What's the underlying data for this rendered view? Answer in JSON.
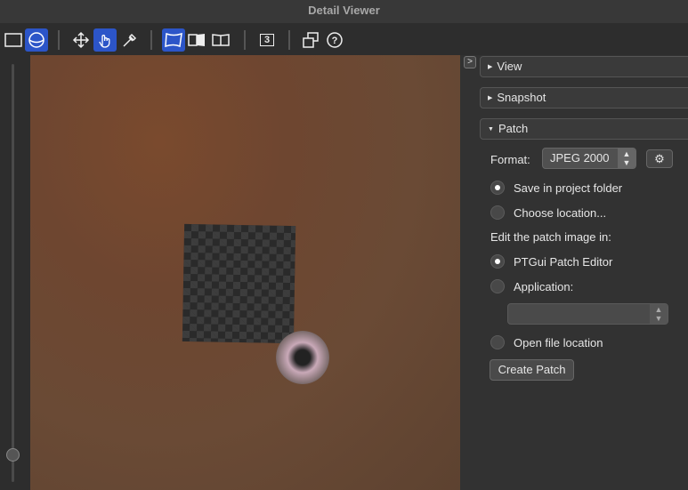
{
  "window": {
    "title": "Detail Viewer"
  },
  "toolbar": {
    "icons": [
      "rectangle-view-icon",
      "sphere-view-icon",
      "move-icon",
      "hand-icon",
      "eyedropper-icon",
      "flat-projection-icon",
      "half-projection-icon",
      "book-projection-icon",
      "three-badge-icon",
      "windows-icon",
      "help-icon"
    ],
    "badge": "3",
    "accent": "#2c55c8"
  },
  "panel": {
    "collapse_label": ">",
    "sections": [
      {
        "label": "View"
      },
      {
        "label": "Snapshot"
      },
      {
        "label": "Patch"
      }
    ],
    "patch": {
      "format_label": "Format:",
      "format_value": "JPEG 2000",
      "save_in_project": "Save in project folder",
      "choose_location": "Choose location...",
      "edit_label": "Edit the patch image in:",
      "ptgui_editor": "PTGui Patch Editor",
      "application": "Application:",
      "open_file_location": "Open file location",
      "create_patch": "Create Patch"
    }
  }
}
